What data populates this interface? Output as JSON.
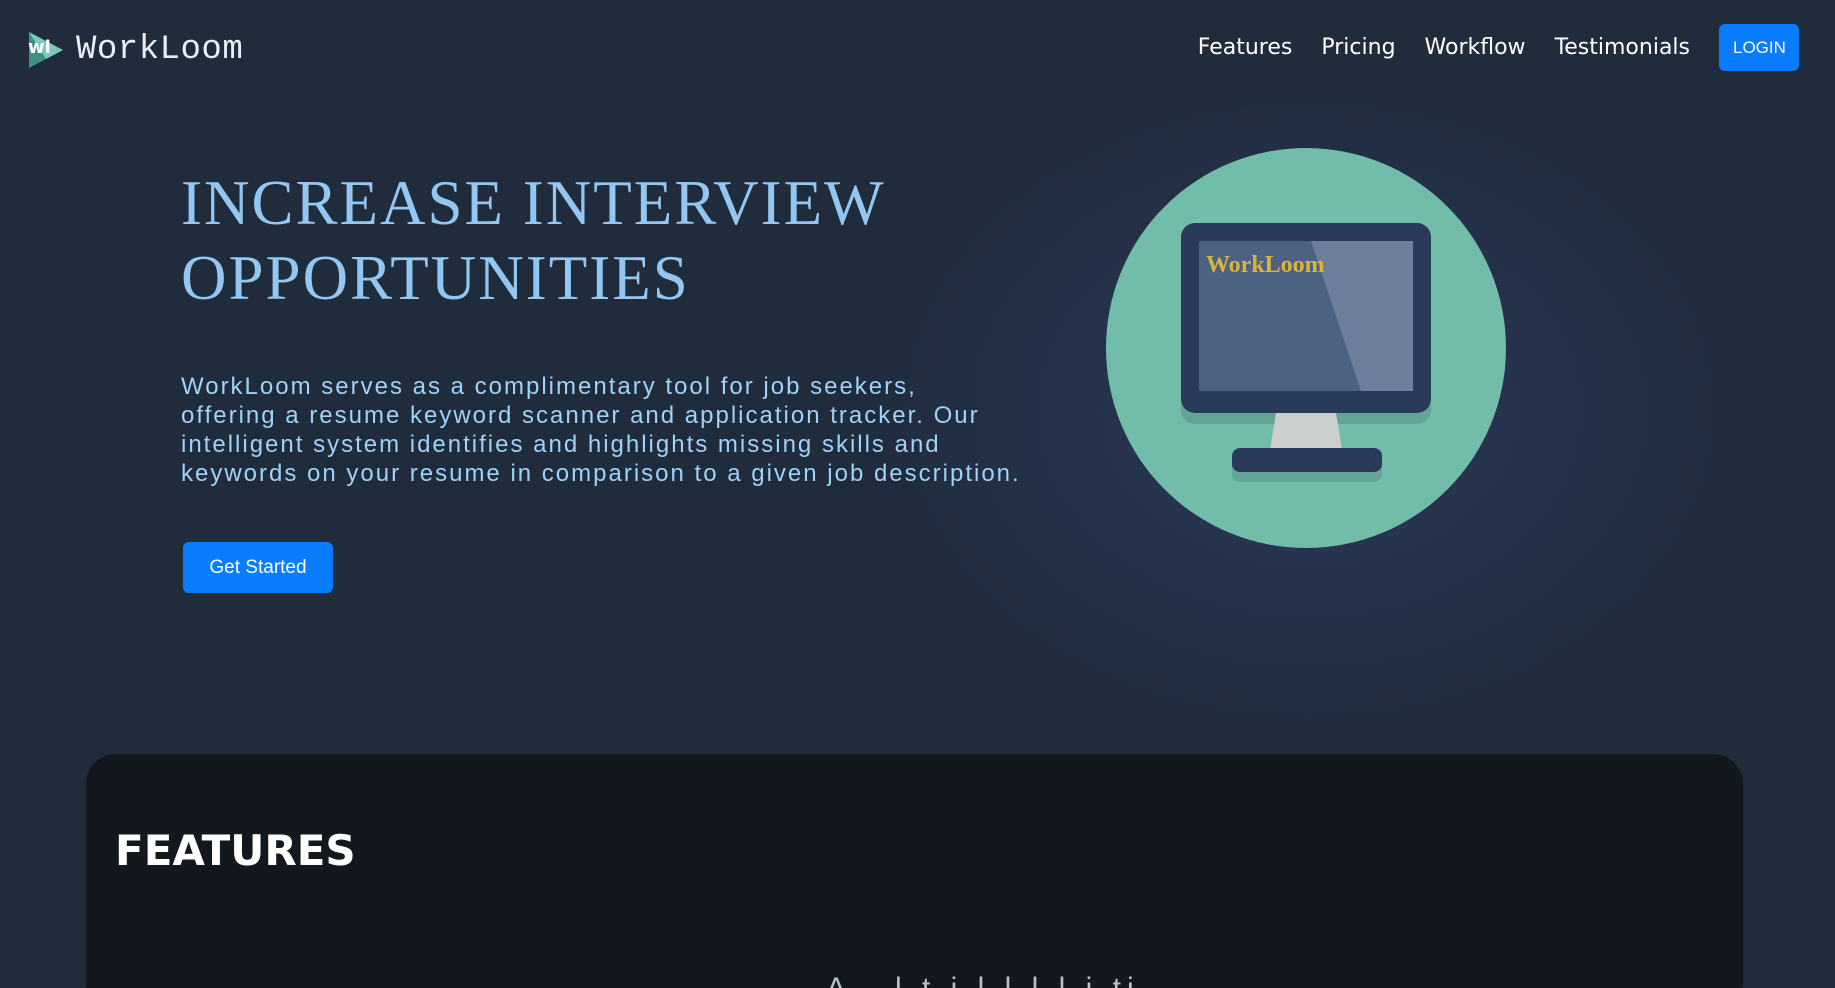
{
  "brand": {
    "logo_initials": "wl",
    "name": "WorkLoom"
  },
  "nav": {
    "links": [
      "Features",
      "Pricing",
      "Workflow",
      "Testimonials"
    ],
    "login_label": "LOGIN"
  },
  "hero": {
    "title_line1": "INCREASE INTERVIEW",
    "title_line2": "OPPORTUNITIES",
    "description": "WorkLoom serves as a complimentary tool for job seekers, offering a resume keyword scanner and application tracker. Our intelligent system identifies and highlights missing skills and keywords on your resume in comparison to a given job description.",
    "cta_label": "Get Started",
    "illustration_screen_text": "WorkLoom",
    "illustration_icon": "computer-monitor-icon"
  },
  "features": {
    "title": "FEATURES",
    "partial_text": "A.. l  t  i l         l    l  l  i  ti"
  },
  "colors": {
    "page_bg": "#202b3c",
    "accent_blue": "#0a7cff",
    "hero_title": "#93c6f2",
    "circle_teal": "#72bcaa",
    "monitor_frame": "#2a3a5a",
    "screen_text": "#d9b43a",
    "features_bg": "#13181f"
  }
}
